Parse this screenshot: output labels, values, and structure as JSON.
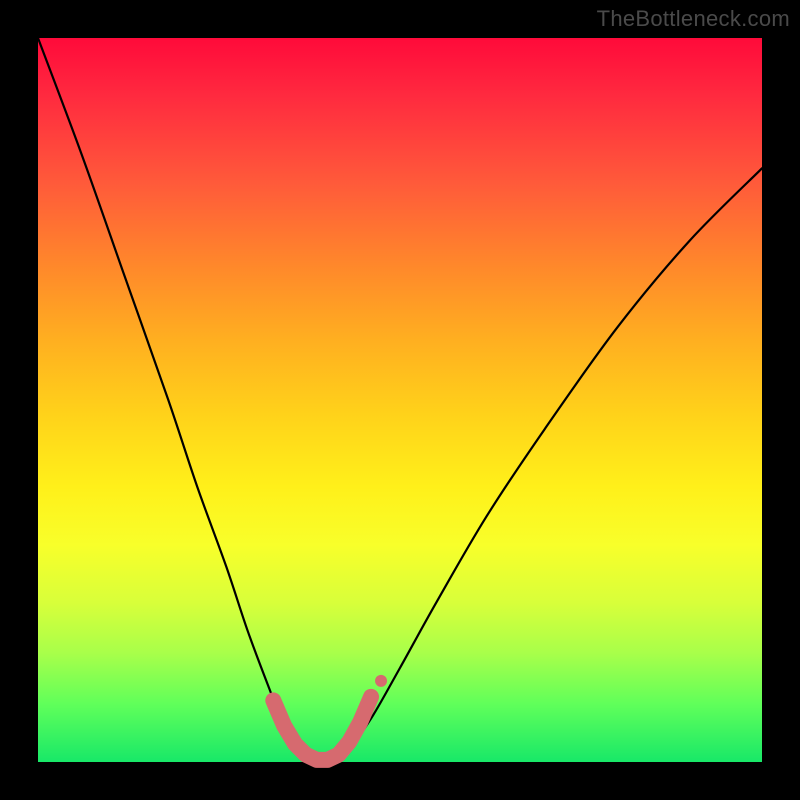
{
  "watermark": "TheBottleneck.com",
  "chart_data": {
    "type": "line",
    "title": "",
    "xlabel": "",
    "ylabel": "",
    "xlim": [
      0,
      100
    ],
    "ylim": [
      0,
      100
    ],
    "series": [
      {
        "name": "bottleneck-curve",
        "x": [
          0,
          6,
          12,
          18,
          22,
          26,
          29,
          32,
          34,
          36,
          38,
          40,
          43,
          46,
          50,
          55,
          62,
          70,
          80,
          90,
          100
        ],
        "values": [
          100,
          84,
          67,
          50,
          38,
          27,
          18,
          10,
          5,
          2,
          0,
          0,
          2,
          6,
          13,
          22,
          34,
          46,
          60,
          72,
          82
        ]
      }
    ],
    "annotations": [
      {
        "name": "trough-marker",
        "type": "points",
        "color": "#d66a6f",
        "x": [
          32.5,
          34.0,
          35.5,
          37.0,
          38.5,
          40.0,
          41.5,
          43.0,
          44.5,
          46.0
        ],
        "values": [
          8.5,
          5.0,
          2.5,
          1.0,
          0.3,
          0.3,
          1.0,
          2.8,
          5.5,
          9.0
        ]
      }
    ]
  }
}
